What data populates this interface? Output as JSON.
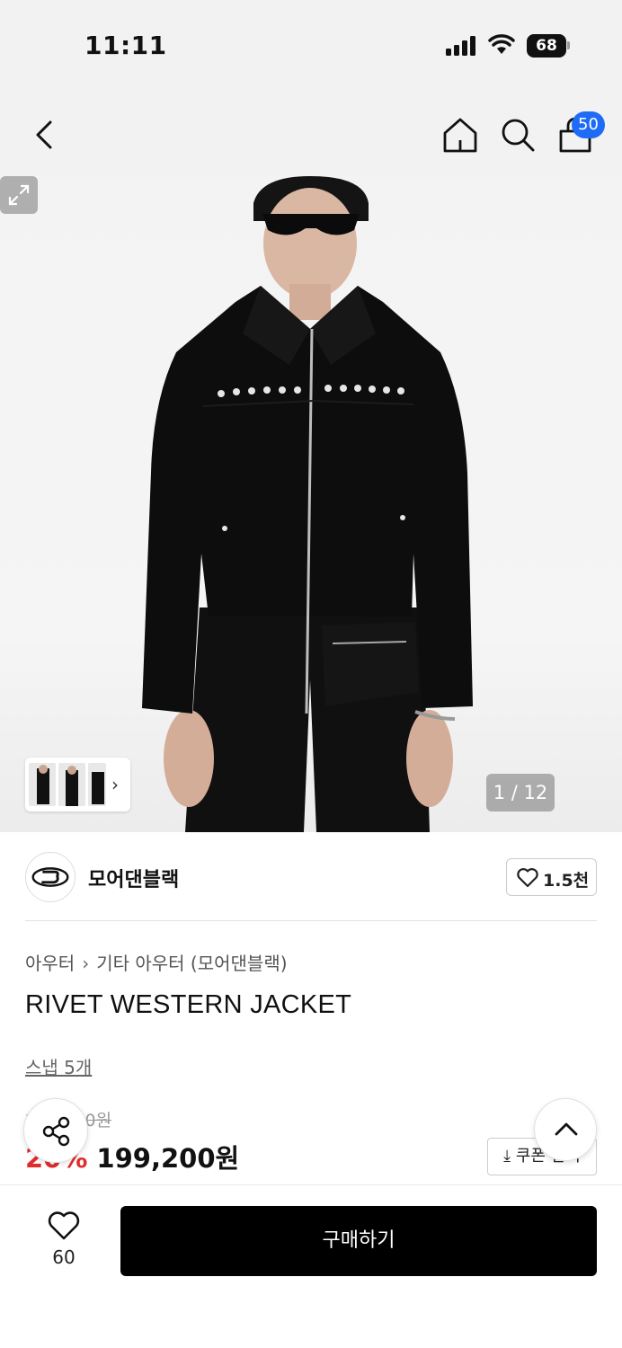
{
  "status_bar": {
    "time": "11:11",
    "battery": "68"
  },
  "nav": {
    "cart_count": "50"
  },
  "gallery": {
    "counter": "1 / 12",
    "colors": {
      "jacket": "#0d0d0d",
      "background": "#f2f2f2",
      "rivets": "#e6e6e6"
    }
  },
  "brand": {
    "name": "모어댄블랙",
    "like_count": "1.5천"
  },
  "product": {
    "breadcrumb": [
      "아우터",
      "기타 아우터 (모어댄블랙)"
    ],
    "title": "RIVET WESTERN JACKET",
    "snap_link": "스냅 5개",
    "original_price": "249,000원",
    "discount_rate": "20%",
    "sale_price": "199,200원",
    "coupon_label": "쿠폰 받기"
  },
  "bottom_bar": {
    "wish_count": "60",
    "buy_label": "구매하기"
  },
  "colors": {
    "accent": "#1e6bf5",
    "discount": "#e22b2b",
    "buy_button": "#000000"
  }
}
